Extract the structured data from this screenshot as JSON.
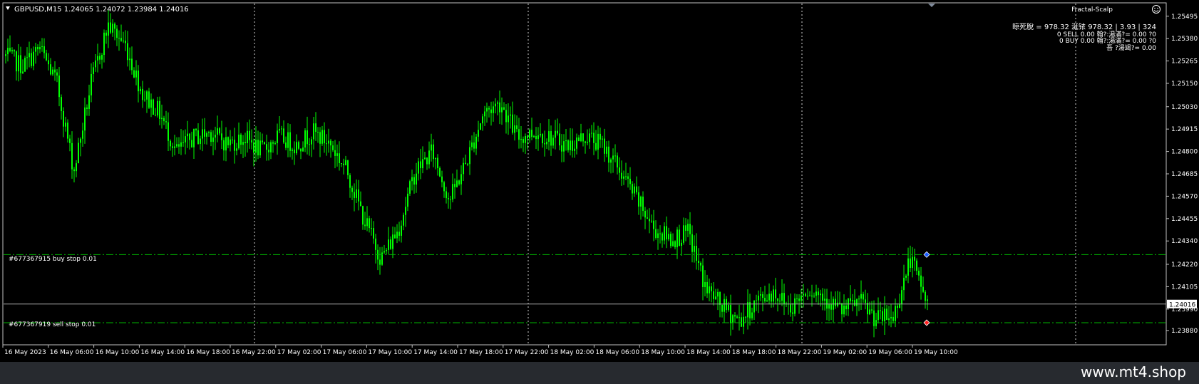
{
  "symbol_header": "GBPUSD,M15  1.24065 1.24072 1.23984 1.24016",
  "indicator_name": "Fractal-Scalp",
  "info_lines": [
    "晾死脫 = 978.32 涎铱 978.32 | 3.93 | 324",
    "0 SELL 0.00 翰?:湯滿?= 0.00 ?0",
    "0 BUY  0.00 翰?:湯滿?= 0.00 ?0",
    "吾   ?湯竭?= 0.00"
  ],
  "orders": [
    {
      "label": "#677367915 buy stop 0.01",
      "price": 1.2427
    },
    {
      "label": "#677367919 sell stop 0.01",
      "price": 1.2392
    }
  ],
  "current_price": 1.24016,
  "current_price_label": "1.24016",
  "price_axis": {
    "min": 1.2381,
    "max": 1.2556,
    "ticks": [
      "1.25495",
      "1.25380",
      "1.25265",
      "1.25150",
      "1.25030",
      "1.24915",
      "1.24800",
      "1.24685",
      "1.24570",
      "1.24455",
      "1.24340",
      "1.24220",
      "1.24105",
      "1.23990",
      "1.23880"
    ]
  },
  "time_axis": [
    "16 May 2023",
    "16 May 06:00",
    "16 May 10:00",
    "16 May 14:00",
    "16 May 18:00",
    "16 May 22:00",
    "17 May 02:00",
    "17 May 06:00",
    "17 May 10:00",
    "17 May 14:00",
    "17 May 18:00",
    "17 May 22:00",
    "18 May 02:00",
    "18 May 06:00",
    "18 May 10:00",
    "18 May 14:00",
    "18 May 18:00",
    "18 May 22:00",
    "19 May 02:00",
    "19 May 06:00",
    "19 May 10:00"
  ],
  "price_path": [
    1.2529,
    1.2524,
    1.2533,
    1.2515,
    1.247,
    1.2515,
    1.2545,
    1.2535,
    1.251,
    1.25,
    1.248,
    1.2487,
    1.249,
    1.2484,
    1.2487,
    1.248,
    1.2488,
    1.2483,
    1.249,
    1.2484,
    1.247,
    1.2445,
    1.2425,
    1.244,
    1.247,
    1.248,
    1.2455,
    1.2475,
    1.25,
    1.2505,
    1.2487,
    1.249,
    1.2487,
    1.2483,
    1.2488,
    1.2483,
    1.247,
    1.2455,
    1.244,
    1.2435,
    1.2438,
    1.241,
    1.24,
    1.2393,
    1.2403,
    1.2408,
    1.24,
    1.241,
    1.2405,
    1.2398,
    1.2403,
    1.2394,
    1.2395,
    1.2425,
    1.2402
  ],
  "colors": {
    "background": "#000000",
    "candle": "#00ff00",
    "order_line": "#00b400",
    "grid": "#d0d0d0",
    "axis_text": "#ffffff",
    "info_text": "#00b400",
    "info_text_top": "#ffffff",
    "price_line": "#aaaaaa",
    "buy_marker": "#1a5cff",
    "sell_marker": "#ff2020"
  },
  "footer": {
    "site": "www.mt4.shop"
  }
}
